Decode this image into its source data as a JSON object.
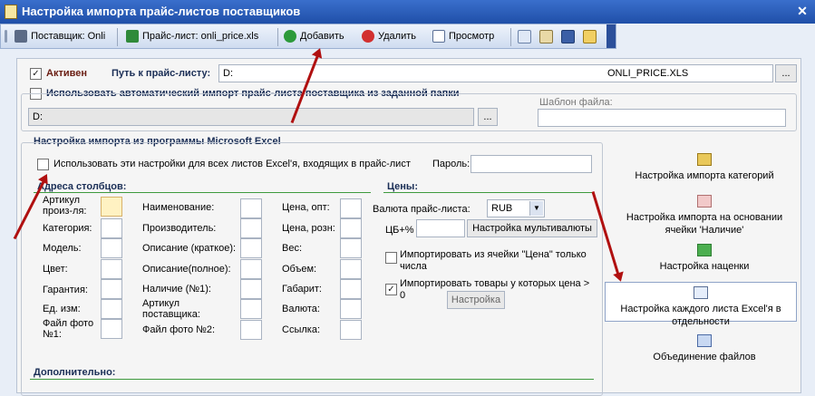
{
  "window": {
    "title": "Настройка импорта прайс-листов поставщиков",
    "close": "✕"
  },
  "toolbar": {
    "supplier": "Поставщик: Onli",
    "pricelist": "Прайс-лист: onli_price.xls",
    "add": "Добавить",
    "delete": "Удалить",
    "view": "Просмотр"
  },
  "main": {
    "active_label": "Активен",
    "active_checked": "✓",
    "path_label": "Путь к прайс-листу:",
    "path_value_left": "D:",
    "path_value_right": "ONLI_PRICE.XLS",
    "browse": "...",
    "auto_import_label": "Использовать автоматический импорт прайс-листа поставщика из заданной папки",
    "auto_folder_value": "D:",
    "template_label": "Шаблон файла:"
  },
  "excel": {
    "section_title": "Настройка импорта из программы Microsoft Excel",
    "all_sheets_label": "Использовать эти настройки для всех листов Excel'я, входящих в прайс-лист",
    "password_label": "Пароль:",
    "columns_title": "Адреса столбцов:",
    "col1": [
      "Артикул произ-ля:",
      "Категория:",
      "Модель:",
      "Цвет:",
      "Гарантия:",
      "Ед. изм:",
      "Файл фото №1:"
    ],
    "col2": [
      "Наименование:",
      "Производитель:",
      "Описание (краткое):",
      "Описание(полное):",
      "Наличие (№1):",
      "Артикул поставщика:",
      "Файл фото №2:"
    ],
    "col3": [
      "Цена, опт:",
      "Цена, розн:",
      "Вес:",
      "Объем:",
      "Габарит:",
      "Валюта:",
      "Ссылка:"
    ],
    "prices_title": "Цены:",
    "currency_label": "Валюта прайс-листа:",
    "currency_value": "RUB",
    "cb_label": "ЦБ+%",
    "multicurrency": "Настройка мультивалюты",
    "import_price_cell": "Импортировать из ячейки \"Цена\" только числа",
    "import_goods_price": "Импортировать товары у которых цена > 0",
    "settings_btn": "Настройка",
    "checked_mark": "✓",
    "additional_title": "Дополнительно:"
  },
  "side": {
    "categories": "Настройка импорта категорий",
    "availability": "Настройка импорта на основании ячейки 'Наличие'",
    "markup": "Настройка наценки",
    "each_sheet": "Настройка каждого листа Excel'я в отдельности",
    "merge": "Объединение файлов"
  },
  "colors": {
    "title_bar": "#2356b4",
    "section_line": "#3e9a3e",
    "annotation_arrow": "#b01010"
  }
}
